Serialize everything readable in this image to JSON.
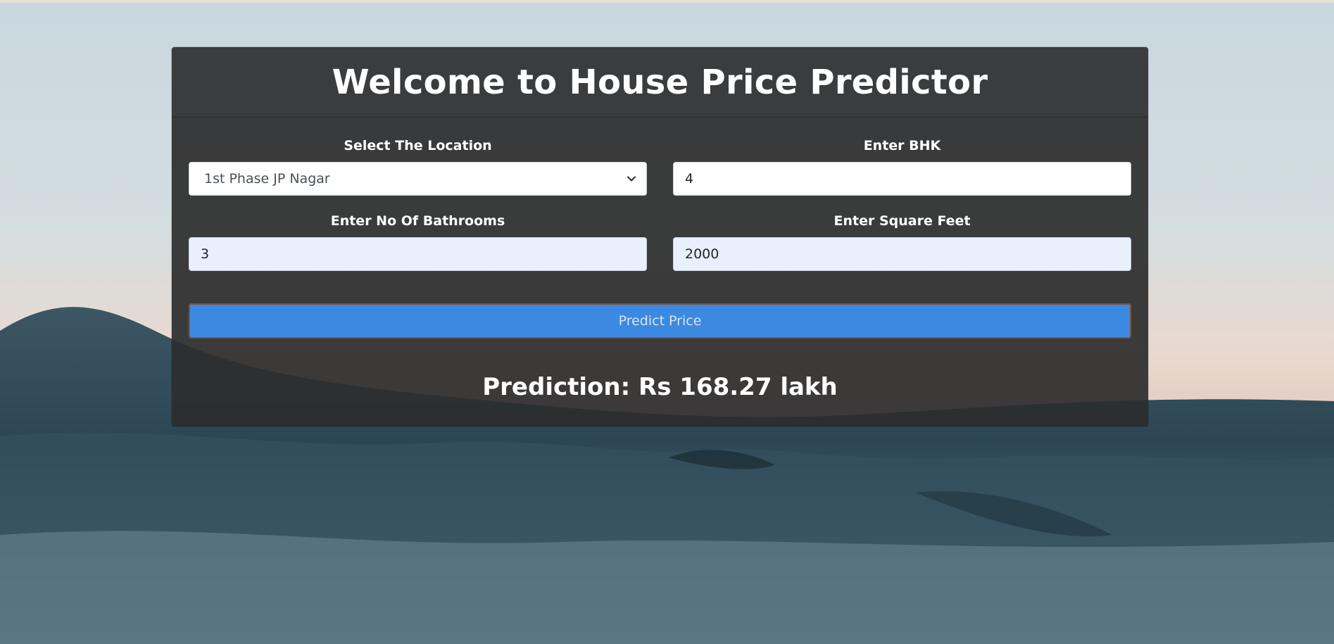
{
  "page": {
    "title": "Welcome to House Price Predictor"
  },
  "form": {
    "location": {
      "label": "Select The Location",
      "selected": "1st Phase JP Nagar"
    },
    "bhk": {
      "label": "Enter BHK",
      "value": "4"
    },
    "bathrooms": {
      "label": "Enter No Of Bathrooms",
      "value": "3"
    },
    "sqft": {
      "label": "Enter Square Feet",
      "value": "2000"
    },
    "predict_label": "Predict Price"
  },
  "result": {
    "text": "Prediction: Rs 168.27 lakh"
  },
  "colors": {
    "button": "#3c89e1",
    "card": "#2d2d2d",
    "autofill_input": "#e8f0fe"
  },
  "icons": {
    "select_arrow": "chevron-down-icon"
  }
}
